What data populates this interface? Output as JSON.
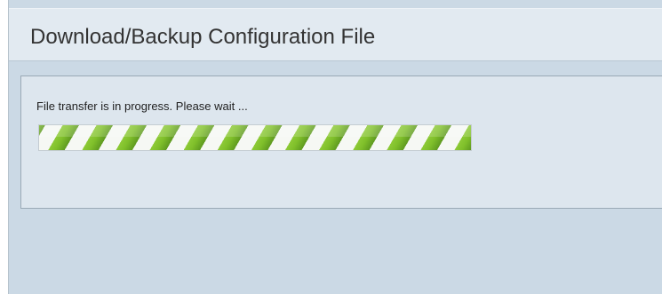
{
  "header": {
    "title": "Download/Backup Configuration File"
  },
  "transfer": {
    "message": "File transfer is in progress. Please wait ...",
    "progress_style": "indeterminate"
  },
  "colors": {
    "background": "#cbd9e5",
    "header_bg": "#e2eaf1",
    "panel_bg": "#dde6ee",
    "progress_green": "#7fbf2a"
  }
}
